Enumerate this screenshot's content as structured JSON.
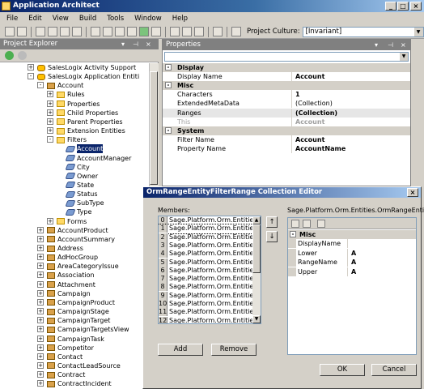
{
  "window": {
    "title": "Application Architect"
  },
  "menu": [
    "File",
    "Edit",
    "View",
    "Build",
    "Tools",
    "Window",
    "Help"
  ],
  "toolbar": {
    "culture_label": "Project Culture:",
    "culture_value": "[Invariant]"
  },
  "explorer": {
    "title": "Project Explorer",
    "tree": [
      {
        "label": "SalesLogix Activity Support",
        "level": 0,
        "icon": "database-icon",
        "exp": "+"
      },
      {
        "label": "SalesLogix Application Entiti",
        "level": 0,
        "icon": "database-icon",
        "exp": "-"
      },
      {
        "label": "Account",
        "level": 1,
        "icon": "entity-icon",
        "exp": "-"
      },
      {
        "label": "Rules",
        "level": 2,
        "icon": "folder-icon",
        "exp": "+"
      },
      {
        "label": "Properties",
        "level": 2,
        "icon": "folder-icon",
        "exp": "+"
      },
      {
        "label": "Child Properties",
        "level": 2,
        "icon": "folder-icon",
        "exp": "+"
      },
      {
        "label": "Parent Properties",
        "level": 2,
        "icon": "folder-icon",
        "exp": "+"
      },
      {
        "label": "Extension Entities",
        "level": 2,
        "icon": "folder-icon",
        "exp": "+"
      },
      {
        "label": "Filters",
        "level": 2,
        "icon": "folder-icon",
        "exp": "-"
      },
      {
        "label": "Account",
        "level": 3,
        "icon": "filter-icon",
        "exp": "",
        "selected": true
      },
      {
        "label": "AccountManager",
        "level": 3,
        "icon": "filter-icon",
        "exp": ""
      },
      {
        "label": "City",
        "level": 3,
        "icon": "filter-icon",
        "exp": ""
      },
      {
        "label": "Owner",
        "level": 3,
        "icon": "filter-icon",
        "exp": ""
      },
      {
        "label": "State",
        "level": 3,
        "icon": "filter-icon",
        "exp": ""
      },
      {
        "label": "Status",
        "level": 3,
        "icon": "filter-icon",
        "exp": ""
      },
      {
        "label": "SubType",
        "level": 3,
        "icon": "filter-icon",
        "exp": ""
      },
      {
        "label": "Type",
        "level": 3,
        "icon": "filter-icon",
        "exp": ""
      },
      {
        "label": "Forms",
        "level": 2,
        "icon": "folder-icon",
        "exp": "+"
      },
      {
        "label": "AccountProduct",
        "level": 1,
        "icon": "entity-icon",
        "exp": "+"
      },
      {
        "label": "AccountSummary",
        "level": 1,
        "icon": "entity-icon",
        "exp": "+"
      },
      {
        "label": "Address",
        "level": 1,
        "icon": "entity-icon",
        "exp": "+"
      },
      {
        "label": "AdHocGroup",
        "level": 1,
        "icon": "entity-icon",
        "exp": "+"
      },
      {
        "label": "AreaCategoryIssue",
        "level": 1,
        "icon": "entity-icon",
        "exp": "+"
      },
      {
        "label": "Association",
        "level": 1,
        "icon": "entity-icon",
        "exp": "+"
      },
      {
        "label": "Attachment",
        "level": 1,
        "icon": "entity-icon",
        "exp": "+"
      },
      {
        "label": "Campaign",
        "level": 1,
        "icon": "entity-icon",
        "exp": "+"
      },
      {
        "label": "CampaignProduct",
        "level": 1,
        "icon": "entity-icon",
        "exp": "+"
      },
      {
        "label": "CampaignStage",
        "level": 1,
        "icon": "entity-icon",
        "exp": "+"
      },
      {
        "label": "CampaignTarget",
        "level": 1,
        "icon": "entity-icon",
        "exp": "+"
      },
      {
        "label": "CampaignTargetsView",
        "level": 1,
        "icon": "entity-icon",
        "exp": "+"
      },
      {
        "label": "CampaignTask",
        "level": 1,
        "icon": "entity-icon",
        "exp": "+"
      },
      {
        "label": "Competitor",
        "level": 1,
        "icon": "entity-icon",
        "exp": "+"
      },
      {
        "label": "Contact",
        "level": 1,
        "icon": "entity-icon",
        "exp": "+"
      },
      {
        "label": "ContactLeadSource",
        "level": 1,
        "icon": "entity-icon",
        "exp": "+"
      },
      {
        "label": "Contract",
        "level": 1,
        "icon": "entity-icon",
        "exp": "+"
      },
      {
        "label": "ContractIncident",
        "level": 1,
        "icon": "entity-icon",
        "exp": "+"
      }
    ]
  },
  "properties": {
    "title": "Properties",
    "rows": [
      {
        "type": "cat",
        "label": "Display"
      },
      {
        "type": "prop",
        "name": "Display Name",
        "value": "Account"
      },
      {
        "type": "cat",
        "label": "Misc"
      },
      {
        "type": "prop",
        "name": "Characters",
        "value": "1"
      },
      {
        "type": "prop",
        "name": "ExtendedMetaData",
        "value": "(Collection)",
        "light": true
      },
      {
        "type": "prop",
        "name": "Ranges",
        "value": "(Collection)",
        "grey": true
      },
      {
        "type": "prop",
        "name": "This",
        "value": "Account",
        "dim": true
      },
      {
        "type": "cat",
        "label": "System"
      },
      {
        "type": "prop",
        "name": "Filter Name",
        "value": "Account"
      },
      {
        "type": "prop",
        "name": "Property Name",
        "value": "AccountName"
      }
    ]
  },
  "dialog": {
    "title": "OrmRangeEntityFilterRange Collection Editor",
    "members_label": "Members:",
    "members": [
      {
        "index": "0",
        "label": "Sage.Platform.Orm.Entities.Orm"
      },
      {
        "index": "1",
        "label": "Sage.Platform.Orm.Entities.Orm"
      },
      {
        "index": "2",
        "label": "Sage.Platform.Orm.Entities.Orm"
      },
      {
        "index": "3",
        "label": "Sage.Platform.Orm.Entities.Orm"
      },
      {
        "index": "4",
        "label": "Sage.Platform.Orm.Entities.Orm"
      },
      {
        "index": "5",
        "label": "Sage.Platform.Orm.Entities.Orm"
      },
      {
        "index": "6",
        "label": "Sage.Platform.Orm.Entities.Orm"
      },
      {
        "index": "7",
        "label": "Sage.Platform.Orm.Entities.Orm"
      },
      {
        "index": "8",
        "label": "Sage.Platform.Orm.Entities.Orm"
      },
      {
        "index": "9",
        "label": "Sage.Platform.Orm.Entities.Orm"
      },
      {
        "index": "10",
        "label": "Sage.Platform.Orm.Entities.Orm"
      },
      {
        "index": "11",
        "label": "Sage.Platform.Orm.Entities.Orm"
      },
      {
        "index": "12",
        "label": "Sage.Platform.Orm.Entities.Orm"
      }
    ],
    "selected_index": 1,
    "add_label": "Add",
    "remove_label": "Remove",
    "props_title": "Sage.Platform.Orm.Entities.OrmRangeEntity...",
    "props": [
      {
        "type": "cat",
        "label": "Misc"
      },
      {
        "type": "prop",
        "name": "DisplayName",
        "value": ""
      },
      {
        "type": "prop",
        "name": "Lower",
        "value": "A"
      },
      {
        "type": "prop",
        "name": "RangeName",
        "value": "A"
      },
      {
        "type": "prop",
        "name": "Upper",
        "value": "A"
      }
    ],
    "ok_label": "OK",
    "cancel_label": "Cancel"
  }
}
